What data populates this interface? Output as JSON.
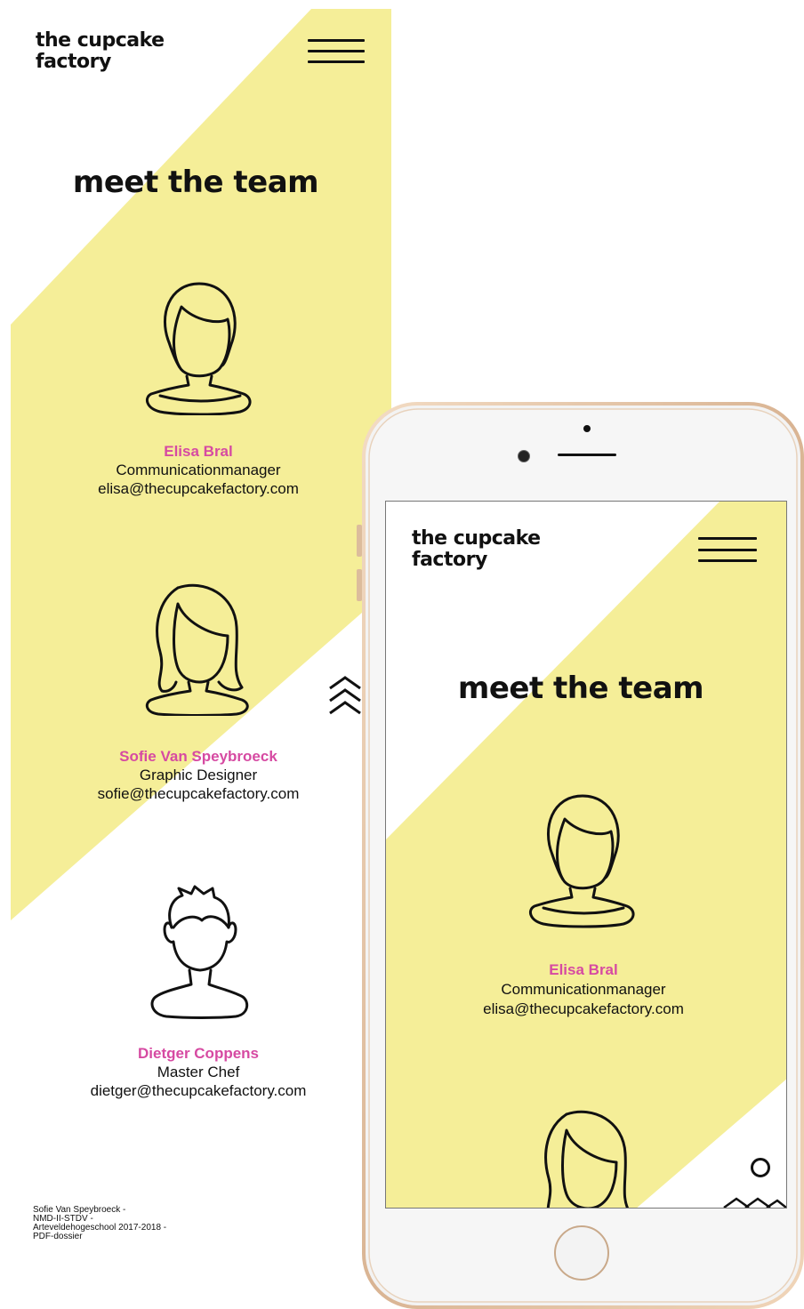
{
  "colors": {
    "accent_yellow": "#f5ee98",
    "name_pink": "#d64aa2",
    "text": "#111111",
    "phone_frame": "#e6c6a6"
  },
  "brand": {
    "line1": "the cupcake",
    "line2": "factory"
  },
  "page": {
    "title": "meet the team",
    "members": [
      {
        "name": "Elisa Bral",
        "role": "Communicationmanager",
        "email": "elisa@thecupcakefactory.com",
        "avatar": "woman-short-hair-icon"
      },
      {
        "name": "Sofie Van Speybroeck",
        "role": "Graphic Designer",
        "email": "sofie@thecupcakefactory.com",
        "avatar": "woman-long-hair-icon"
      },
      {
        "name": "Dietger Coppens",
        "role": "Master Chef",
        "email": "dietger@thecupcakefactory.com",
        "avatar": "man-spiky-hair-icon"
      }
    ],
    "footer": [
      "Sofie Van Speybroeck -",
      "NMD-II-STDV -",
      "Arteveldehogeschool 2017-2018 -",
      "PDF-dossier"
    ]
  },
  "icons": {
    "menu": "hamburger-menu-icon",
    "scroll_top": "chevron-up-triple-icon",
    "circle": "circle-outline-icon"
  }
}
